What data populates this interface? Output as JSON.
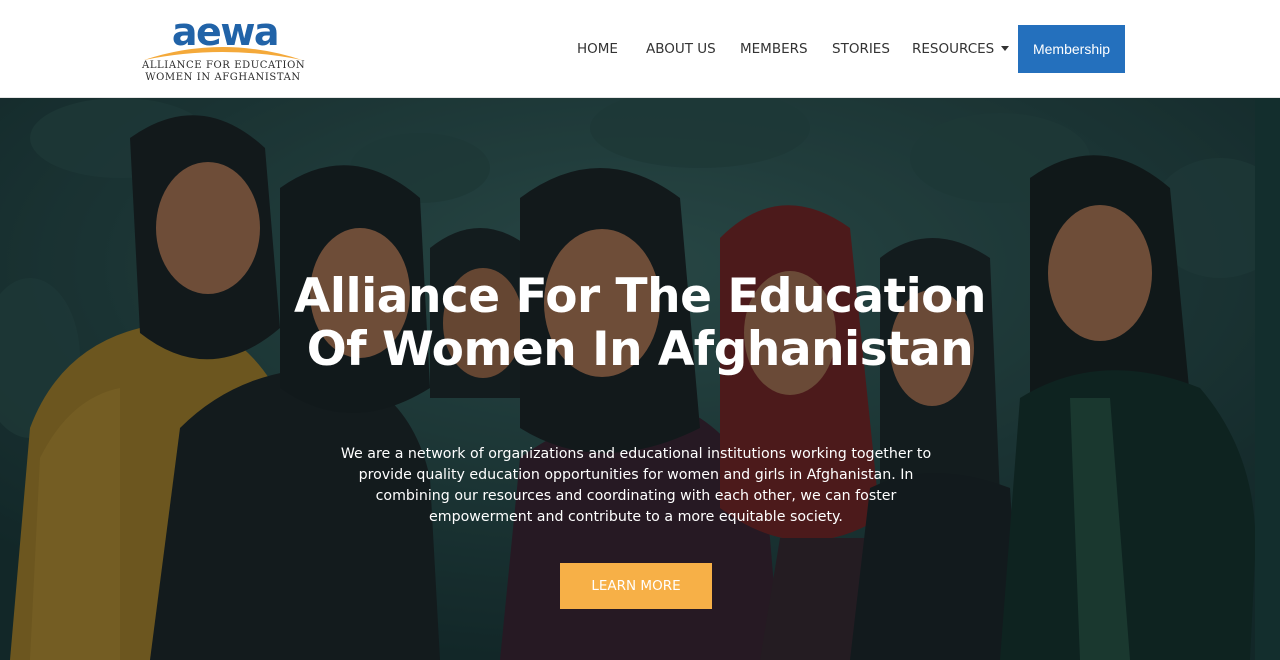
{
  "logo": {
    "wordmark": "aewa",
    "line1": "Alliance for Education",
    "line2": "Women in Afghanistan",
    "colors": {
      "wordmark": "#2163a8",
      "swoosh": "#f4a93a"
    }
  },
  "nav": {
    "items": [
      {
        "label": "HOME"
      },
      {
        "label": "ABOUT US"
      },
      {
        "label": "MEMBERS"
      },
      {
        "label": "STORIES"
      },
      {
        "label": "RESOURCES",
        "has_dropdown": true,
        "icon": "caret-down-icon"
      }
    ],
    "membership_label": "Membership"
  },
  "hero": {
    "title": "Alliance For The Education Of Women In Afghanistan",
    "description": "We are a network of organizations and educational institutions working together to provide quality education opportunities for women and girls in Afghanistan. In combining our resources and coordinating with each other, we can foster empowerment and contribute to a more equitable society.",
    "cta_label": "LEARN MORE",
    "image_subject": "illustration-group-of-afghan-women-in-headscarves"
  },
  "colors": {
    "primary_blue": "#2470bd",
    "cta_orange": "#f7b047",
    "nav_text": "#333333"
  }
}
